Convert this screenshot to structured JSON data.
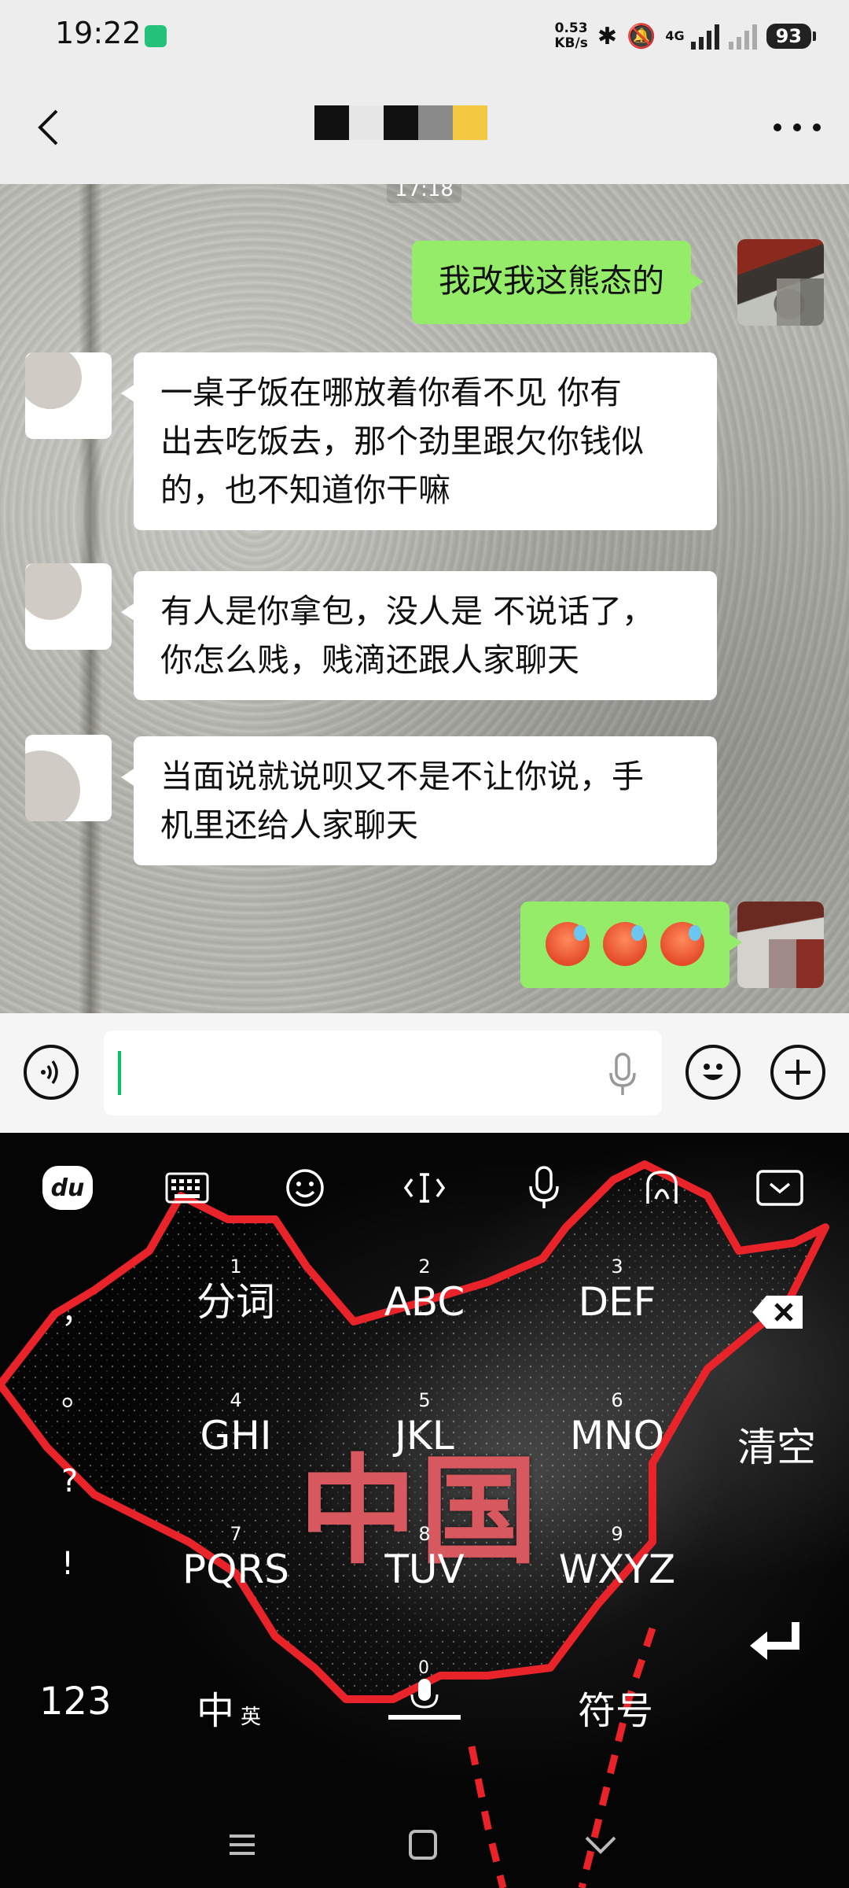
{
  "status_bar": {
    "time": "19:22",
    "net_speed_value": "0.53",
    "net_speed_unit": "KB/s",
    "network_type": "4G",
    "battery": "93"
  },
  "title_bar": {
    "redacted_colors": [
      "#111111",
      "#e6e6e6",
      "#111111",
      "#8a8a8a",
      "#f5c842"
    ]
  },
  "chat": {
    "timestamp": "17:18",
    "messages": [
      {
        "side": "self",
        "text": "我改我这熊态的"
      },
      {
        "side": "other",
        "lines": [
          "一桌子饭在哪放着你看不见 你有",
          "出去吃饭去，那个劲里跟欠你钱似",
          "的，也不知道你干嘛"
        ]
      },
      {
        "side": "other",
        "lines": [
          "有人是你拿包，没人是 不说话了，",
          "你怎么贱，贱滴还跟人家聊天"
        ]
      },
      {
        "side": "other",
        "lines": [
          "当面说就说呗又不是不让你说，手",
          "机里还给人家聊天"
        ]
      },
      {
        "side": "self",
        "emoji": "overheated-face-emoji",
        "count": 3
      }
    ]
  },
  "input_bar": {
    "voice_icon": "voice-icon",
    "mic_icon": "mic-icon",
    "emoji_icon": "emoji-icon",
    "plus_icon": "plus-icon"
  },
  "keyboard": {
    "map_title": "中国",
    "toolbar_logo": "du",
    "keys": [
      {
        "num": "1",
        "label": "分词"
      },
      {
        "num": "2",
        "label": "ABC"
      },
      {
        "num": "3",
        "label": "DEF"
      },
      {
        "num": "4",
        "label": "GHI"
      },
      {
        "num": "5",
        "label": "JKL"
      },
      {
        "num": "6",
        "label": "MNO"
      },
      {
        "num": "7",
        "label": "PQRS"
      },
      {
        "num": "8",
        "label": "TUV"
      },
      {
        "num": "9",
        "label": "WXYZ"
      }
    ],
    "side_punct": [
      "，",
      "。",
      "?",
      "!"
    ],
    "clear_label": "清空",
    "numbers_label": "123",
    "lang_main": "中",
    "lang_sub": "英",
    "space_num": "0",
    "symbols_label": "符号"
  }
}
